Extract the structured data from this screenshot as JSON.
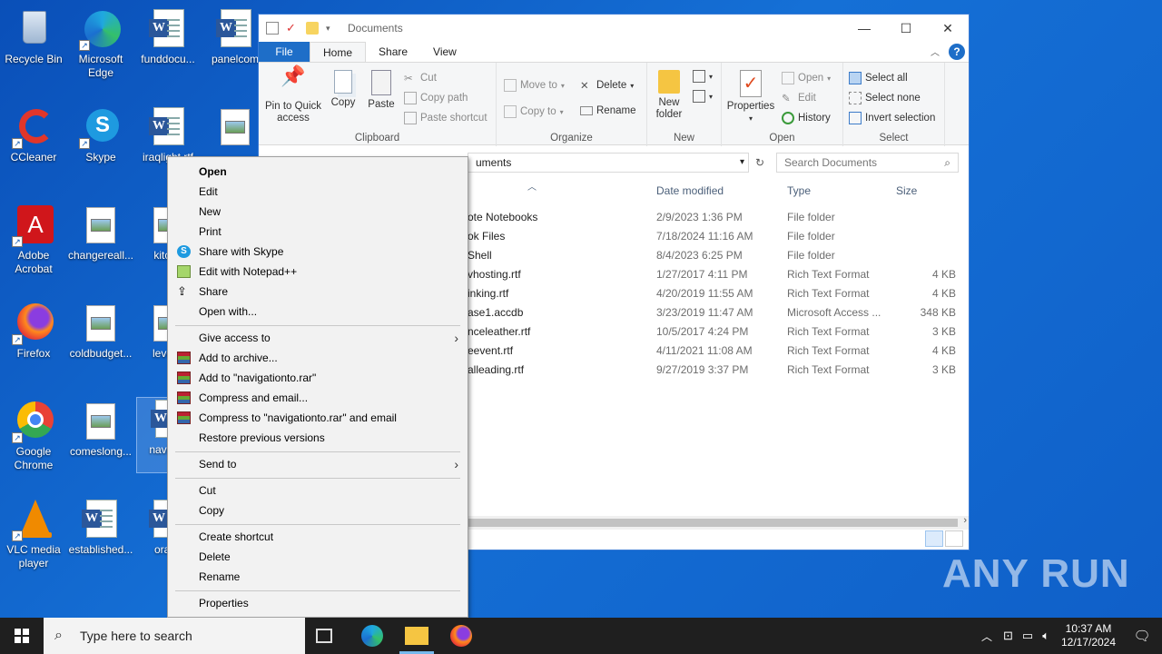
{
  "desktop": {
    "icons": [
      {
        "label": "Recycle Bin"
      },
      {
        "label": "Microsoft Edge"
      },
      {
        "label": "funddocu..."
      },
      {
        "label": "panelcom"
      },
      {
        "label": "CCleaner"
      },
      {
        "label": "Skype"
      },
      {
        "label": "iraqlight.rtf"
      },
      {
        "label": "Adobe Acrobat"
      },
      {
        "label": "changereall..."
      },
      {
        "label": "kitche"
      },
      {
        "label": "Firefox"
      },
      {
        "label": "coldbudget..."
      },
      {
        "label": "levelin"
      },
      {
        "label": "Google Chrome"
      },
      {
        "label": "comeslong..."
      },
      {
        "label": "naviga n"
      },
      {
        "label": "VLC media player"
      },
      {
        "label": "established..."
      },
      {
        "label": "oralfu"
      }
    ]
  },
  "explorer": {
    "title": "Documents",
    "tabs": [
      "File",
      "Home",
      "Share",
      "View"
    ],
    "help": "?",
    "ribbon": {
      "clipboard": {
        "group": "Clipboard",
        "pin": "Pin to Quick access",
        "copy": "Copy",
        "paste": "Paste",
        "cut": "Cut",
        "copy_path": "Copy path",
        "paste_shortcut": "Paste shortcut"
      },
      "organize": {
        "group": "Organize",
        "move_to": "Move to",
        "copy_to": "Copy to",
        "delete": "Delete",
        "rename": "Rename"
      },
      "new": {
        "group": "New",
        "new_folder": "New folder"
      },
      "open": {
        "group": "Open",
        "properties": "Properties",
        "open": "Open",
        "edit": "Edit",
        "history": "History"
      },
      "select": {
        "group": "Select",
        "select_all": "Select all",
        "select_none": "Select none",
        "invert": "Invert selection"
      }
    },
    "address": "uments",
    "search_placeholder": "Search Documents",
    "columns": {
      "date": "Date modified",
      "type": "Type",
      "size": "Size"
    },
    "files": [
      {
        "name": "ote Notebooks",
        "date": "2/9/2023 1:36 PM",
        "type": "File folder",
        "size": ""
      },
      {
        "name": "ok Files",
        "date": "7/18/2024 11:16 AM",
        "type": "File folder",
        "size": ""
      },
      {
        "name": "Shell",
        "date": "8/4/2023 6:25 PM",
        "type": "File folder",
        "size": ""
      },
      {
        "name": "vhosting.rtf",
        "date": "1/27/2017 4:11 PM",
        "type": "Rich Text Format",
        "size": "4 KB"
      },
      {
        "name": "inking.rtf",
        "date": "4/20/2019 11:55 AM",
        "type": "Rich Text Format",
        "size": "4 KB"
      },
      {
        "name": "ase1.accdb",
        "date": "3/23/2019 11:47 AM",
        "type": "Microsoft Access ...",
        "size": "348 KB"
      },
      {
        "name": "nceleather.rtf",
        "date": "10/5/2017 4:24 PM",
        "type": "Rich Text Format",
        "size": "3 KB"
      },
      {
        "name": "eevent.rtf",
        "date": "4/11/2021 11:08 AM",
        "type": "Rich Text Format",
        "size": "4 KB"
      },
      {
        "name": "alleading.rtf",
        "date": "9/27/2019 3:37 PM",
        "type": "Rich Text Format",
        "size": "3 KB"
      }
    ]
  },
  "context_menu": {
    "items": [
      "Open",
      "Edit",
      "New",
      "Print",
      "Share with Skype",
      "Edit with Notepad++",
      "Share",
      "Open with...",
      "Give access to",
      "Add to archive...",
      "Add to \"navigationto.rar\"",
      "Compress and email...",
      "Compress to \"navigationto.rar\" and email",
      "Restore previous versions",
      "Send to",
      "Cut",
      "Copy",
      "Create shortcut",
      "Delete",
      "Rename",
      "Properties"
    ]
  },
  "taskbar": {
    "search_placeholder": "Type here to search",
    "time": "10:37 AM",
    "date": "12/17/2024"
  },
  "watermark": "ANY RUN"
}
